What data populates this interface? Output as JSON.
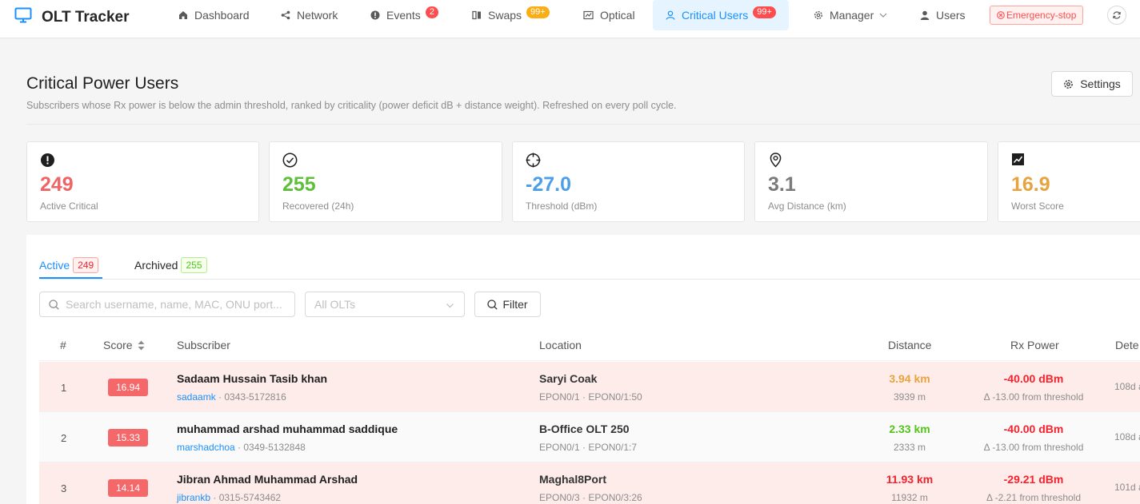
{
  "app": {
    "title": "OLT Tracker"
  },
  "nav": {
    "items": [
      {
        "label": "Dashboard",
        "icon": "home-icon"
      },
      {
        "label": "Network",
        "icon": "share-icon"
      },
      {
        "label": "Events",
        "icon": "alert-icon",
        "badge": "2"
      },
      {
        "label": "Swaps",
        "icon": "swap-icon",
        "badge": "99+"
      },
      {
        "label": "Optical",
        "icon": "optical-icon"
      },
      {
        "label": "Critical Users",
        "icon": "user-icon",
        "badge": "99+",
        "active": true
      },
      {
        "label": "Manager",
        "icon": "gear-icon"
      },
      {
        "label": "Users",
        "icon": "person-icon"
      }
    ],
    "emergency_label": "Emergency-stop"
  },
  "page": {
    "title": "Critical Power Users",
    "subtitle": "Subscribers whose Rx power is below the admin threshold, ranked by criticality (power deficit dB + distance weight). Refreshed on every poll cycle.",
    "settings_label": "Settings"
  },
  "stats": [
    {
      "value": "249",
      "label": "Active Critical",
      "color": "#ef6565",
      "icon": "exclamation-circle-icon"
    },
    {
      "value": "255",
      "label": "Recovered (24h)",
      "color": "#5fbf3b",
      "icon": "check-circle-icon"
    },
    {
      "value": "-27.0",
      "label": "Threshold (dBm)",
      "color": "#4a9fe8",
      "icon": "crosshair-icon"
    },
    {
      "value": "3.1",
      "label": "Avg Distance (km)",
      "color": "#7a7a7a",
      "icon": "location-pin-icon"
    },
    {
      "value": "16.9",
      "label": "Worst Score",
      "color": "#e8a33e",
      "icon": "trend-chart-icon"
    }
  ],
  "tabs": [
    {
      "label": "Active",
      "count": "249"
    },
    {
      "label": "Archived",
      "count": "255"
    }
  ],
  "filters": {
    "search_placeholder": "Search username, name, MAC, ONU port...",
    "olt_select": "All OLTs",
    "filter_label": "Filter"
  },
  "table": {
    "columns": [
      "#",
      "Score",
      "Subscriber",
      "Location",
      "Distance",
      "Rx Power",
      "Dete"
    ],
    "rows": [
      {
        "index": "1",
        "score": "16.94",
        "name": "Sadaam Hussain Tasib khan",
        "username": "sadaamk",
        "phone": " · 0343-5172816",
        "location": "Saryi Coak",
        "port": "EPON0/1 · EPON0/1:50",
        "distance_km": "3.94 km",
        "distance_color": "#e8a33e",
        "distance_m": "3939 m",
        "rx": "-40.00 dBm",
        "rx_delta": "Δ -13.00 from threshold",
        "detected": "108d a"
      },
      {
        "index": "2",
        "score": "15.33",
        "name": "muhammad arshad muhammad saddique",
        "username": "marshadchoa",
        "phone": " · 0349-5132848",
        "location": "B-Office OLT 250",
        "port": "EPON0/1 · EPON0/1:7",
        "distance_km": "2.33 km",
        "distance_color": "#52c41a",
        "distance_m": "2333 m",
        "rx": "-40.00 dBm",
        "rx_delta": "Δ -13.00 from threshold",
        "detected": "108d a"
      },
      {
        "index": "3",
        "score": "14.14",
        "name": "Jibran Ahmad Muhammad Arshad",
        "username": "jibrankb",
        "phone": " · 0315-5743462",
        "location": "Maghal8Port",
        "port": "EPON0/3 · EPON0/3:26",
        "distance_km": "11.93 km",
        "distance_color": "#f5222d",
        "distance_m": "11932 m",
        "rx": "-29.21 dBm",
        "rx_delta": "Δ -2.21 from threshold",
        "detected": "101d a"
      }
    ]
  }
}
